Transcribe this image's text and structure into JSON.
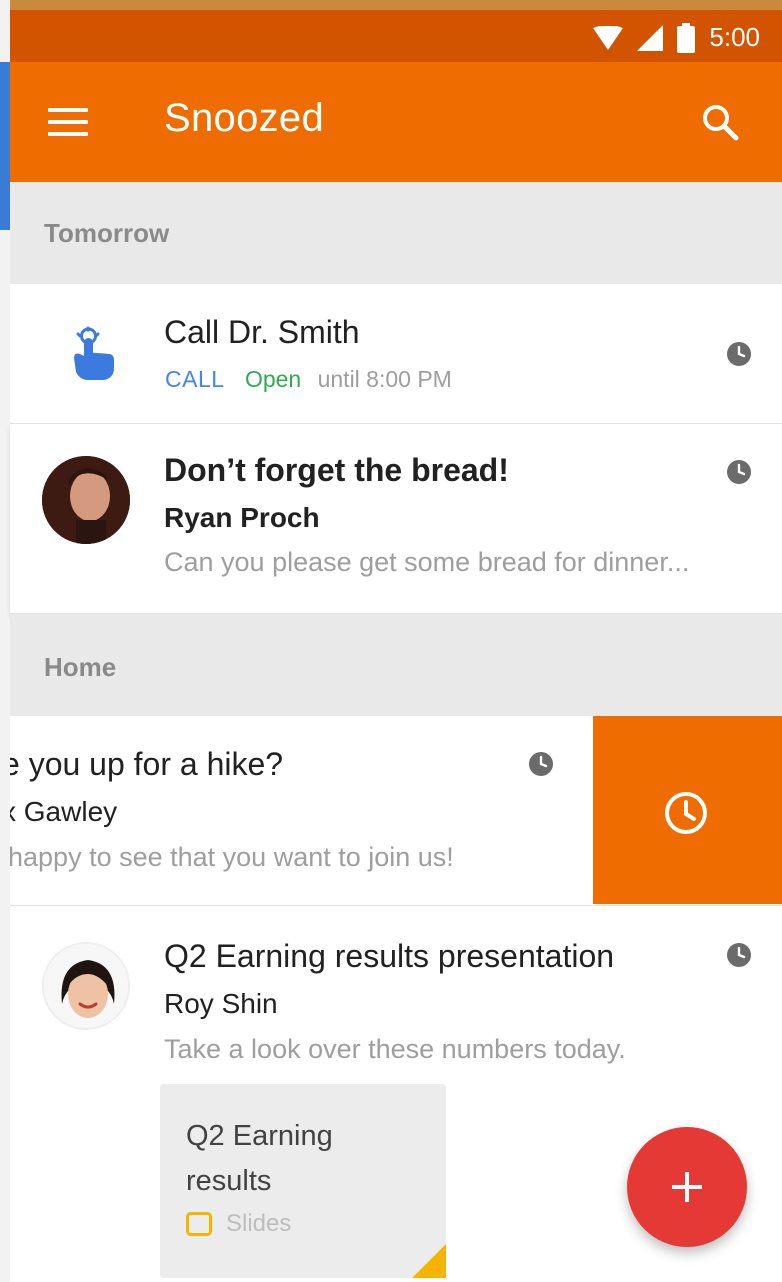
{
  "status_bar": {
    "time": "5:00"
  },
  "app_bar": {
    "title": "Snoozed"
  },
  "sections": {
    "tomorrow": {
      "header": "Tomorrow",
      "items": [
        {
          "title": "Call Dr. Smith",
          "tag_call": "CALL",
          "tag_open": "Open",
          "hours": "until 8:00 PM"
        },
        {
          "title": "Don’t forget the bread!",
          "sender": "Ryan Proch",
          "snippet": "Can you please get some bread for dinner..."
        }
      ]
    },
    "home": {
      "header": "Home",
      "items": [
        {
          "title": "e you up for a hike?",
          "sender": "x Gawley",
          "snippet": "happy to see that you want to join us!"
        },
        {
          "title": "Q2 Earning results presentation",
          "sender": "Roy Shin",
          "snippet": "Take a look over these numbers today.",
          "attachment": {
            "title": "Q2 Earning results",
            "type": "Slides"
          }
        }
      ]
    }
  },
  "colors": {
    "status_bar": "#d35400",
    "app_bar": "#ef6c00",
    "fab": "#e53935",
    "call_tag": "#4285f4",
    "open_tag": "#34a853",
    "slides_icon": "#f6b400"
  },
  "icons": {
    "menu": "menu-icon",
    "search": "search-icon",
    "snooze_clock": "clock-icon",
    "fab": "plus-icon",
    "call_action": "tap-hand-icon",
    "attachment_type": "slides-icon"
  }
}
